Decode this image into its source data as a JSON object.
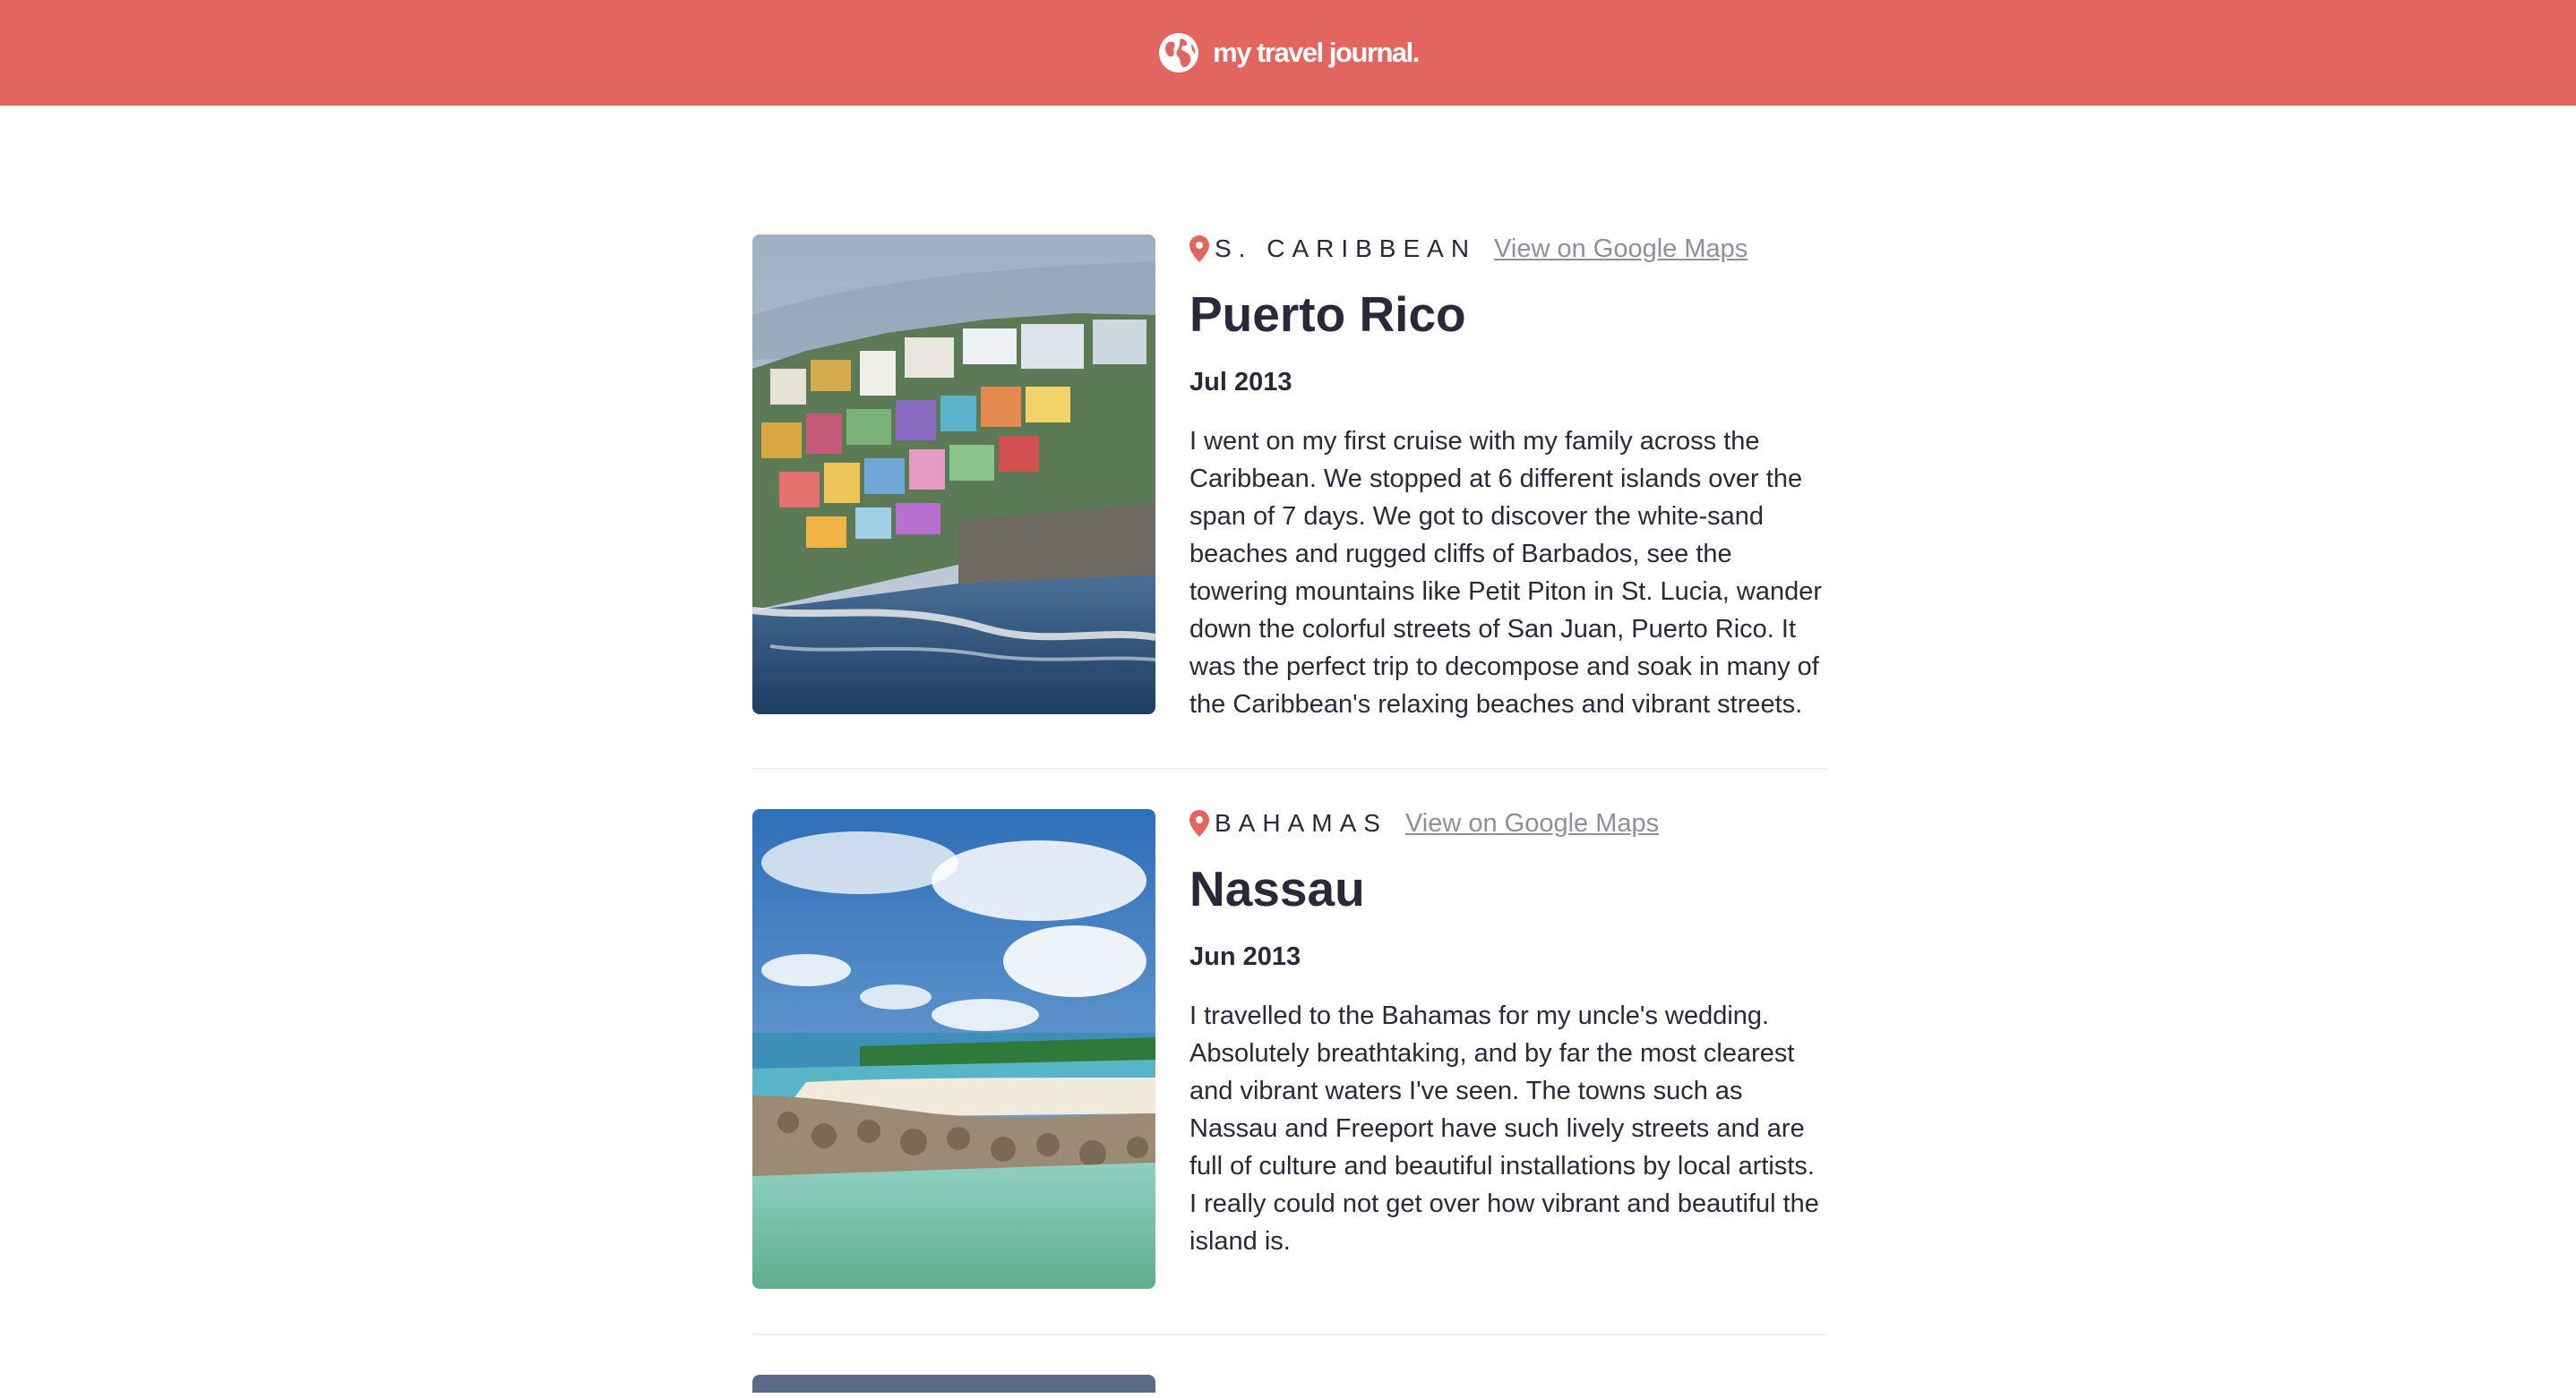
{
  "header": {
    "brand": "my travel journal.",
    "icon": "globe-icon",
    "color": "#e3655f"
  },
  "entries": [
    {
      "location": "S. CARIBBEAN",
      "map_link": "View on Google Maps",
      "title": "Puerto Rico",
      "date": "Jul 2013",
      "description": "I went on my first cruise with my family across the Caribbean. We stopped at 6 different islands over the span of 7 days. We got to discover the white-sand beaches and rugged cliffs of Barbados, see the towering mountains like Petit Piton in St. Lucia, wander down the colorful streets of San Juan, Puerto Rico. It was the perfect trip to decompose and soak in many of the Caribbean's relaxing beaches and vibrant streets."
    },
    {
      "location": "BAHAMAS",
      "map_link": "View on Google Maps",
      "title": "Nassau",
      "date": "Jun 2013",
      "description": "I travelled to the Bahamas for my uncle's wedding. Absolutely breathtaking, and by far the most clearest and vibrant waters I've seen. The towns such as Nassau and Freeport have such lively streets and are full of culture and beautiful installations by local artists. I really could not get over how vibrant and beautiful the island is."
    }
  ]
}
